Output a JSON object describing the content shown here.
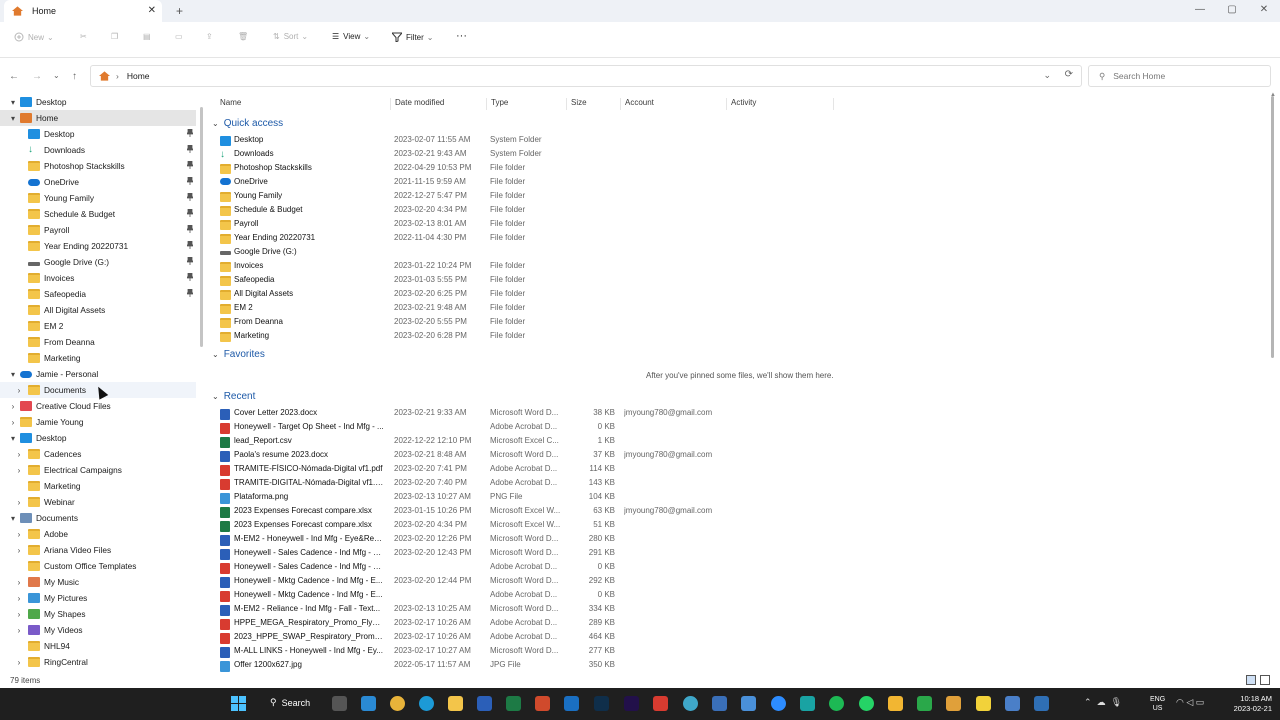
{
  "tab": {
    "title": "Home",
    "close": "✕",
    "new": "+"
  },
  "window_controls": {
    "min": "—",
    "max": "▢",
    "close": "✕"
  },
  "toolbar": {
    "new_label": "New",
    "sort_label": "Sort",
    "view_label": "View",
    "filter_label": "Filter",
    "more_label": "···"
  },
  "address": {
    "path": "Home",
    "search_placeholder": "Search Home"
  },
  "sidebar": [
    {
      "label": "Desktop",
      "level": 0,
      "chev": "▾",
      "icon": "desktop",
      "color": "#1f8fe0"
    },
    {
      "label": "Home",
      "level": 0,
      "chev": "▾",
      "icon": "home",
      "color": "#e07a2e",
      "selected": true
    },
    {
      "label": "Desktop",
      "level": 1,
      "icon": "desktop",
      "color": "#1f8fe0",
      "pinned": true
    },
    {
      "label": "Downloads",
      "level": 1,
      "icon": "download",
      "color": "#1aa37a",
      "pinned": true
    },
    {
      "label": "Photoshop Stackskills",
      "level": 1,
      "icon": "folder",
      "color": "#f3c54a",
      "pinned": true
    },
    {
      "label": "OneDrive",
      "level": 1,
      "icon": "cloud",
      "color": "#1473d1",
      "pinned": true
    },
    {
      "label": "Young Family",
      "level": 1,
      "icon": "folder",
      "color": "#f3c54a",
      "pinned": true
    },
    {
      "label": "Schedule & Budget",
      "level": 1,
      "icon": "folder",
      "color": "#f3c54a",
      "pinned": true
    },
    {
      "label": "Payroll",
      "level": 1,
      "icon": "folder",
      "color": "#f3c54a",
      "pinned": true
    },
    {
      "label": "Year Ending 20220731",
      "level": 1,
      "icon": "folder",
      "color": "#f3c54a",
      "pinned": true
    },
    {
      "label": "Google Drive (G:)",
      "level": 1,
      "icon": "drive",
      "color": "#666666",
      "pinned": true
    },
    {
      "label": "Invoices",
      "level": 1,
      "icon": "folder",
      "color": "#f3c54a",
      "pinned": true
    },
    {
      "label": "Safeopedia",
      "level": 1,
      "icon": "folder",
      "color": "#f3c54a",
      "pinned": true
    },
    {
      "label": "All Digital Assets",
      "level": 1,
      "icon": "folder",
      "color": "#f3c54a"
    },
    {
      "label": "EM 2",
      "level": 1,
      "icon": "folder",
      "color": "#f3c54a"
    },
    {
      "label": "From Deanna",
      "level": 1,
      "icon": "folder",
      "color": "#f3c54a"
    },
    {
      "label": "Marketing",
      "level": 1,
      "icon": "folder",
      "color": "#f3c54a"
    },
    {
      "label": "Jamie - Personal",
      "level": 0,
      "chev": "▾",
      "icon": "cloud",
      "color": "#1473d1"
    },
    {
      "label": "Documents",
      "level": 1,
      "chev": "›",
      "icon": "folder",
      "color": "#f3c54a",
      "hover": true
    },
    {
      "label": "Creative Cloud Files",
      "level": 0,
      "chev": "›",
      "icon": "cc",
      "color": "#e34850"
    },
    {
      "label": "Jamie Young",
      "level": 0,
      "chev": "›",
      "icon": "folder",
      "color": "#f3c54a"
    },
    {
      "label": "Desktop",
      "level": 0,
      "chev": "▾",
      "icon": "desktop",
      "color": "#1f8fe0"
    },
    {
      "label": "Cadences",
      "level": 1,
      "chev": "›",
      "icon": "folder",
      "color": "#f3c54a"
    },
    {
      "label": "Electrical Campaigns",
      "level": 1,
      "chev": "›",
      "icon": "folder",
      "color": "#f3c54a"
    },
    {
      "label": "Marketing",
      "level": 1,
      "icon": "folder",
      "color": "#f3c54a"
    },
    {
      "label": "Webinar",
      "level": 1,
      "chev": "›",
      "icon": "folder",
      "color": "#f3c54a"
    },
    {
      "label": "Documents",
      "level": 0,
      "chev": "▾",
      "icon": "docs",
      "color": "#6d8fb8"
    },
    {
      "label": "Adobe",
      "level": 1,
      "chev": "›",
      "icon": "folder",
      "color": "#f3c54a"
    },
    {
      "label": "Ariana Video Files",
      "level": 1,
      "chev": "›",
      "icon": "folder",
      "color": "#f3c54a"
    },
    {
      "label": "Custom Office Templates",
      "level": 1,
      "icon": "folder",
      "color": "#f3c54a"
    },
    {
      "label": "My Music",
      "level": 1,
      "chev": "›",
      "icon": "music",
      "color": "#e0784a"
    },
    {
      "label": "My Pictures",
      "level": 1,
      "chev": "›",
      "icon": "pictures",
      "color": "#3a95d8"
    },
    {
      "label": "My Shapes",
      "level": 1,
      "chev": "›",
      "icon": "shapes",
      "color": "#4fa84a"
    },
    {
      "label": "My Videos",
      "level": 1,
      "chev": "›",
      "icon": "video",
      "color": "#7a5ac8"
    },
    {
      "label": "NHL94",
      "level": 1,
      "icon": "folder",
      "color": "#f3c54a"
    },
    {
      "label": "RingCentral",
      "level": 1,
      "chev": "›",
      "icon": "folder",
      "color": "#f3c54a"
    }
  ],
  "columns": [
    "Name",
    "Date modified",
    "Type",
    "Size",
    "Account",
    "Activity"
  ],
  "groups": {
    "quick_access": "Quick access",
    "favorites": "Favorites",
    "recent": "Recent"
  },
  "quick_access": [
    {
      "name": "Desktop",
      "date": "2023-02-07 11:55 AM",
      "type": "System Folder",
      "icon": "desktop",
      "color": "#1f8fe0"
    },
    {
      "name": "Downloads",
      "date": "2023-02-21 9:43 AM",
      "type": "System Folder",
      "icon": "download",
      "color": "#1aa37a"
    },
    {
      "name": "Photoshop Stackskills",
      "date": "2022-04-29 10:53 PM",
      "type": "File folder",
      "icon": "folder",
      "color": "#f3c54a"
    },
    {
      "name": "OneDrive",
      "date": "2021-11-15 9:59 AM",
      "type": "File folder",
      "icon": "cloud",
      "color": "#1473d1"
    },
    {
      "name": "Young Family",
      "date": "2022-12-27 5:47 PM",
      "type": "File folder",
      "icon": "folder",
      "color": "#f3c54a"
    },
    {
      "name": "Schedule & Budget",
      "date": "2023-02-20 4:34 PM",
      "type": "File folder",
      "icon": "folder",
      "color": "#f3c54a"
    },
    {
      "name": "Payroll",
      "date": "2023-02-13 8:01 AM",
      "type": "File folder",
      "icon": "folder",
      "color": "#f3c54a"
    },
    {
      "name": "Year Ending 20220731",
      "date": "2022-11-04 4:30 PM",
      "type": "File folder",
      "icon": "folder",
      "color": "#f3c54a"
    },
    {
      "name": "Google Drive (G:)",
      "date": "",
      "type": "",
      "icon": "drive",
      "color": "#666666"
    },
    {
      "name": "Invoices",
      "date": "2023-01-22 10:24 PM",
      "type": "File folder",
      "icon": "folder",
      "color": "#f3c54a"
    },
    {
      "name": "Safeopedia",
      "date": "2023-01-03 5:55 PM",
      "type": "File folder",
      "icon": "folder",
      "color": "#f3c54a"
    },
    {
      "name": "All Digital Assets",
      "date": "2023-02-20 6:25 PM",
      "type": "File folder",
      "icon": "folder",
      "color": "#f3c54a"
    },
    {
      "name": "EM 2",
      "date": "2023-02-21 9:48 AM",
      "type": "File folder",
      "icon": "folder",
      "color": "#f3c54a"
    },
    {
      "name": "From Deanna",
      "date": "2023-02-20 5:55 PM",
      "type": "File folder",
      "icon": "folder",
      "color": "#f3c54a"
    },
    {
      "name": "Marketing",
      "date": "2023-02-20 6:28 PM",
      "type": "File folder",
      "icon": "folder",
      "color": "#f3c54a"
    }
  ],
  "favorites_empty": "After you've pinned some files, we'll show them here.",
  "recent": [
    {
      "name": "Cover Letter 2023.docx",
      "date": "2023-02-21 9:33 AM",
      "type": "Microsoft Word D...",
      "size": "38 KB",
      "account": "jmyoung780@gmail.com",
      "icon": "word",
      "color": "#2b5fb8"
    },
    {
      "name": "Honeywell - Target Op Sheet - Ind Mfg - ...",
      "date": "",
      "type": "Adobe Acrobat D...",
      "size": "0 KB",
      "account": "",
      "icon": "pdf",
      "color": "#d83b30"
    },
    {
      "name": "lead_Report.csv",
      "date": "2022-12-22 12:10 PM",
      "type": "Microsoft Excel C...",
      "size": "1 KB",
      "account": "",
      "icon": "excel",
      "color": "#1d7a45"
    },
    {
      "name": "Paola's resume 2023.docx",
      "date": "2023-02-21 8:48 AM",
      "type": "Microsoft Word D...",
      "size": "37 KB",
      "account": "jmyoung780@gmail.com",
      "icon": "word",
      "color": "#2b5fb8"
    },
    {
      "name": "TRAMITE-FÍSICO-Nómada-Digital vf1.pdf",
      "date": "2023-02-20 7:41 PM",
      "type": "Adobe Acrobat D...",
      "size": "114 KB",
      "account": "",
      "icon": "pdf",
      "color": "#d83b30"
    },
    {
      "name": "TRAMITE-DIGITAL-Nómada-Digital vf1.pdf",
      "date": "2023-02-20 7:40 PM",
      "type": "Adobe Acrobat D...",
      "size": "143 KB",
      "account": "",
      "icon": "pdf",
      "color": "#d83b30"
    },
    {
      "name": "Plataforma.png",
      "date": "2023-02-13 10:27 AM",
      "type": "PNG File",
      "size": "104 KB",
      "account": "",
      "icon": "image",
      "color": "#3a95d8"
    },
    {
      "name": "2023 Expenses Forecast compare.xlsx",
      "date": "2023-01-15 10:26 PM",
      "type": "Microsoft Excel W...",
      "size": "63 KB",
      "account": "jmyoung780@gmail.com",
      "icon": "excel",
      "color": "#1d7a45"
    },
    {
      "name": "2023 Expenses Forecast compare.xlsx",
      "date": "2023-02-20 4:34 PM",
      "type": "Microsoft Excel W...",
      "size": "51 KB",
      "account": "",
      "icon": "excel",
      "color": "#1d7a45"
    },
    {
      "name": "M-EM2 - Honeywell - Ind Mfg - Eye&Res...",
      "date": "2023-02-20 12:26 PM",
      "type": "Microsoft Word D...",
      "size": "280 KB",
      "account": "",
      "icon": "word",
      "color": "#2b5fb8"
    },
    {
      "name": "Honeywell - Sales Cadence - Ind Mfg - E...",
      "date": "2023-02-20 12:43 PM",
      "type": "Microsoft Word D...",
      "size": "291 KB",
      "account": "",
      "icon": "word",
      "color": "#2b5fb8"
    },
    {
      "name": "Honeywell - Sales Cadence - Ind Mfg - E...",
      "date": "",
      "type": "Adobe Acrobat D...",
      "size": "0 KB",
      "account": "",
      "icon": "pdf",
      "color": "#d83b30"
    },
    {
      "name": "Honeywell - Mktg Cadence - Ind Mfg - E...",
      "date": "2023-02-20 12:44 PM",
      "type": "Microsoft Word D...",
      "size": "292 KB",
      "account": "",
      "icon": "word",
      "color": "#2b5fb8"
    },
    {
      "name": "Honeywell - Mktg Cadence - Ind Mfg - E...",
      "date": "",
      "type": "Adobe Acrobat D...",
      "size": "0 KB",
      "account": "",
      "icon": "pdf",
      "color": "#d83b30"
    },
    {
      "name": "M-EM2 - Reliance - Ind Mfg - Fall - Text...",
      "date": "2023-02-13 10:25 AM",
      "type": "Microsoft Word D...",
      "size": "334 KB",
      "account": "",
      "icon": "word",
      "color": "#2b5fb8"
    },
    {
      "name": "HPPE_MEGA_Respiratory_Promo_Flyer_C...",
      "date": "2023-02-17 10:26 AM",
      "type": "Adobe Acrobat D...",
      "size": "289 KB",
      "account": "",
      "icon": "pdf",
      "color": "#d83b30"
    },
    {
      "name": "2023_HPPE_SWAP_Respiratory_Promo_Fl...",
      "date": "2023-02-17 10:26 AM",
      "type": "Adobe Acrobat D...",
      "size": "464 KB",
      "account": "",
      "icon": "pdf",
      "color": "#d83b30"
    },
    {
      "name": "M-ALL LINKS - Honeywell - Ind Mfg - Ey...",
      "date": "2023-02-17 10:27 AM",
      "type": "Microsoft Word D...",
      "size": "277 KB",
      "account": "",
      "icon": "word",
      "color": "#2b5fb8"
    },
    {
      "name": "Offer 1200x627.jpg",
      "date": "2022-05-17 11:57 AM",
      "type": "JPG File",
      "size": "350 KB",
      "account": "",
      "icon": "image",
      "color": "#3a95d8"
    }
  ],
  "status": {
    "count": "79 items"
  },
  "taskbar": {
    "search_label": "Search",
    "lang_top": "ENG",
    "lang_bottom": "US",
    "time": "10:18 AM",
    "date": "2023-02-21",
    "apps": [
      {
        "name": "task-view",
        "color": "#555555"
      },
      {
        "name": "skype",
        "color": "#2a8ad4"
      },
      {
        "name": "chrome",
        "color": "#e8b33a"
      },
      {
        "name": "edge",
        "color": "#1c9ad6"
      },
      {
        "name": "file-explorer",
        "color": "#f3c54a"
      },
      {
        "name": "word",
        "color": "#2b5fb8"
      },
      {
        "name": "excel",
        "color": "#1d7a45"
      },
      {
        "name": "powerpoint",
        "color": "#d04a2c"
      },
      {
        "name": "outlook",
        "color": "#1a6fc2"
      },
      {
        "name": "photoshop",
        "color": "#0f2e4a"
      },
      {
        "name": "premiere",
        "color": "#22104a"
      },
      {
        "name": "acrobat",
        "color": "#d83b30"
      },
      {
        "name": "browser",
        "color": "#3fa7c9"
      },
      {
        "name": "calculator",
        "color": "#3a6fb8"
      },
      {
        "name": "notepad",
        "color": "#4a90d9"
      },
      {
        "name": "zoom",
        "color": "#2d8cff"
      },
      {
        "name": "snipping",
        "color": "#19a3a3"
      },
      {
        "name": "spotify",
        "color": "#1db954"
      },
      {
        "name": "whatsapp",
        "color": "#25d366"
      },
      {
        "name": "sticky",
        "color": "#f2b632"
      },
      {
        "name": "app-green",
        "color": "#2aa84a"
      },
      {
        "name": "slack",
        "color": "#e0a03a"
      },
      {
        "name": "notes-yellow",
        "color": "#f2d23a"
      },
      {
        "name": "photos",
        "color": "#4a7fc8"
      },
      {
        "name": "app-blue",
        "color": "#2f6fb5"
      }
    ]
  }
}
